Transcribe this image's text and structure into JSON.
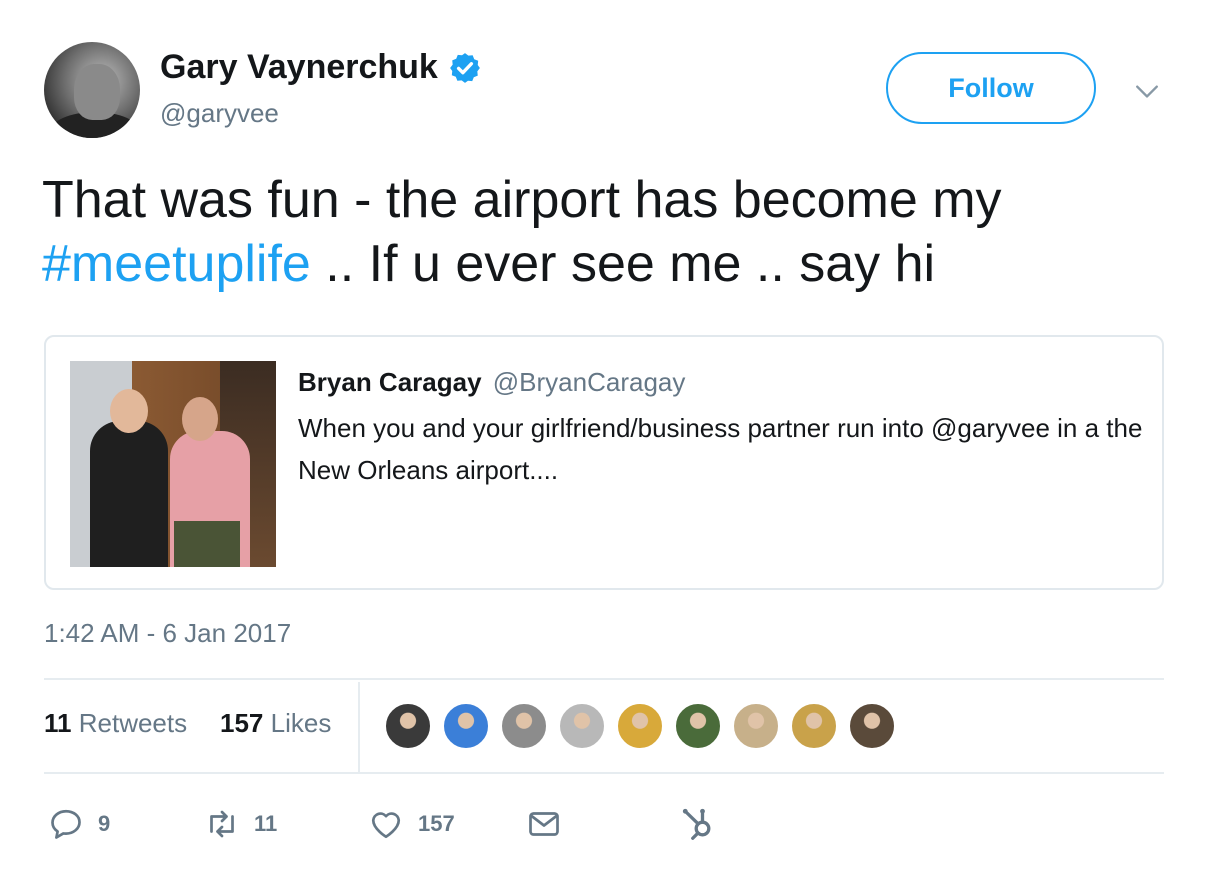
{
  "author": {
    "name": "Gary Vaynerchuk",
    "handle": "@garyvee",
    "verified": true
  },
  "follow_label": "Follow",
  "tweet": {
    "text_before": "That was fun - the airport has become my",
    "hashtag": "#meetuplife",
    "text_after": " .. If u ever see me .. say hi"
  },
  "quoted_tweet": {
    "name": "Bryan Caragay",
    "handle": "@BryanCaragay",
    "text": "When you and your girlfriend/business partner run into @garyvee in a the New Orleans airport...."
  },
  "timestamp": "1:42 AM - 6 Jan 2017",
  "stats": {
    "retweets_count": "11",
    "retweets_label": "Retweets",
    "likes_count": "157",
    "likes_label": "Likes"
  },
  "likers": [
    {
      "name": "liker-avatar-1",
      "color": "#3a3a3a"
    },
    {
      "name": "liker-avatar-2",
      "color": "#3b7fd8"
    },
    {
      "name": "liker-avatar-3",
      "color": "#8c8c8c"
    },
    {
      "name": "liker-avatar-4",
      "color": "#b8b8b8"
    },
    {
      "name": "liker-avatar-5",
      "color": "#d8a93a"
    },
    {
      "name": "liker-avatar-6",
      "color": "#4a6b3a"
    },
    {
      "name": "liker-avatar-7",
      "color": "#c7b08a"
    },
    {
      "name": "liker-avatar-8",
      "color": "#c9a24a"
    },
    {
      "name": "liker-avatar-9",
      "color": "#5a4a3a"
    }
  ],
  "actions": {
    "reply_count": "9",
    "retweet_count": "11",
    "like_count": "157"
  },
  "colors": {
    "accent": "#1da1f2",
    "muted": "#657786",
    "text": "#14171a",
    "border": "#e1e8ed"
  },
  "icons": [
    "verified-badge-icon",
    "chevron-down-icon",
    "reply-icon",
    "retweet-icon",
    "like-heart-icon",
    "direct-message-icon",
    "hubspot-icon"
  ]
}
